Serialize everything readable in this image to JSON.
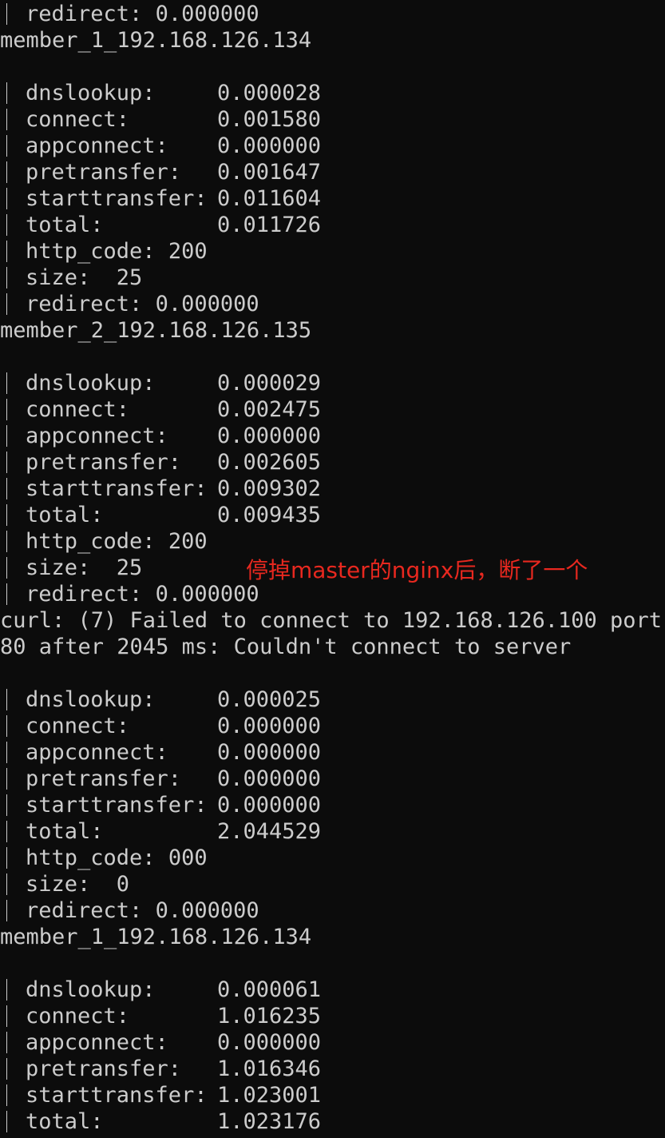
{
  "terminal": {
    "colors": {
      "background": "#0c0c0c",
      "text": "#cccccc",
      "annotation": "#e8281f"
    },
    "annotation": "停掉master的nginx后，断了一个",
    "lines": [
      {
        "type": "metric",
        "label": "redirect:",
        "value": "0.000000",
        "aligned": false
      },
      {
        "type": "text",
        "text": "member_1_192.168.126.134"
      },
      {
        "type": "blank"
      },
      {
        "type": "metric",
        "label": "dnslookup:",
        "value": "0.000028",
        "aligned": true
      },
      {
        "type": "metric",
        "label": "connect:",
        "value": "0.001580",
        "aligned": true
      },
      {
        "type": "metric",
        "label": "appconnect:",
        "value": "0.000000",
        "aligned": true
      },
      {
        "type": "metric",
        "label": "pretransfer:",
        "value": "0.001647",
        "aligned": true
      },
      {
        "type": "metric",
        "label": "starttransfer:",
        "value": "0.011604",
        "aligned": true
      },
      {
        "type": "metric",
        "label": "total:",
        "value": "0.011726",
        "aligned": true
      },
      {
        "type": "metric",
        "label": "http_code:",
        "value": "200",
        "aligned": false
      },
      {
        "type": "metric",
        "label": "size:",
        "value": " 25",
        "aligned": false
      },
      {
        "type": "metric",
        "label": "redirect:",
        "value": "0.000000",
        "aligned": false
      },
      {
        "type": "text",
        "text": "member_2_192.168.126.135"
      },
      {
        "type": "blank"
      },
      {
        "type": "metric",
        "label": "dnslookup:",
        "value": "0.000029",
        "aligned": true
      },
      {
        "type": "metric",
        "label": "connect:",
        "value": "0.002475",
        "aligned": true
      },
      {
        "type": "metric",
        "label": "appconnect:",
        "value": "0.000000",
        "aligned": true
      },
      {
        "type": "metric",
        "label": "pretransfer:",
        "value": "0.002605",
        "aligned": true
      },
      {
        "type": "metric",
        "label": "starttransfer:",
        "value": "0.009302",
        "aligned": true
      },
      {
        "type": "metric",
        "label": "total:",
        "value": "0.009435",
        "aligned": true
      },
      {
        "type": "metric",
        "label": "http_code:",
        "value": "200",
        "aligned": false
      },
      {
        "type": "metric",
        "label": "size:",
        "value": " 25",
        "aligned": false
      },
      {
        "type": "metric",
        "label": "redirect:",
        "value": "0.000000",
        "aligned": false
      },
      {
        "type": "text",
        "text": "curl: (7) Failed to connect to 192.168.126.100 port"
      },
      {
        "type": "text",
        "text": "80 after 2045 ms: Couldn't connect to server"
      },
      {
        "type": "blank"
      },
      {
        "type": "metric",
        "label": "dnslookup:",
        "value": "0.000025",
        "aligned": true
      },
      {
        "type": "metric",
        "label": "connect:",
        "value": "0.000000",
        "aligned": true
      },
      {
        "type": "metric",
        "label": "appconnect:",
        "value": "0.000000",
        "aligned": true
      },
      {
        "type": "metric",
        "label": "pretransfer:",
        "value": "0.000000",
        "aligned": true
      },
      {
        "type": "metric",
        "label": "starttransfer:",
        "value": "0.000000",
        "aligned": true
      },
      {
        "type": "metric",
        "label": "total:",
        "value": "2.044529",
        "aligned": true
      },
      {
        "type": "metric",
        "label": "http_code:",
        "value": "000",
        "aligned": false
      },
      {
        "type": "metric",
        "label": "size:",
        "value": " 0",
        "aligned": false
      },
      {
        "type": "metric",
        "label": "redirect:",
        "value": "0.000000",
        "aligned": false
      },
      {
        "type": "text",
        "text": "member_1_192.168.126.134"
      },
      {
        "type": "blank"
      },
      {
        "type": "metric",
        "label": "dnslookup:",
        "value": "0.000061",
        "aligned": true
      },
      {
        "type": "metric",
        "label": "connect:",
        "value": "1.016235",
        "aligned": true
      },
      {
        "type": "metric",
        "label": "appconnect:",
        "value": "0.000000",
        "aligned": true
      },
      {
        "type": "metric",
        "label": "pretransfer:",
        "value": "1.016346",
        "aligned": true
      },
      {
        "type": "metric",
        "label": "starttransfer:",
        "value": "1.023001",
        "aligned": true
      },
      {
        "type": "metric",
        "label": "total:",
        "value": "1.023176",
        "aligned": true
      }
    ]
  }
}
